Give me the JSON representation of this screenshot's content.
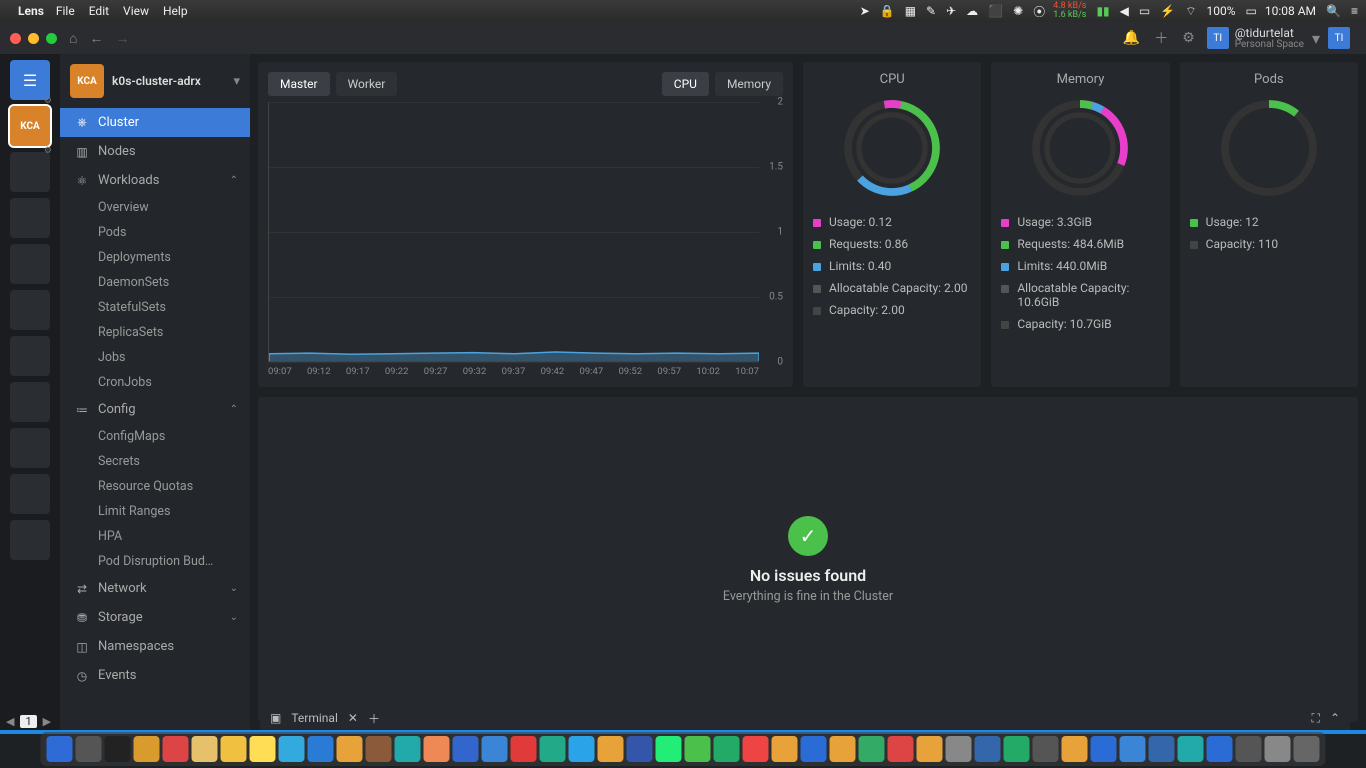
{
  "menubar": {
    "app": "Lens",
    "items": [
      "File",
      "Edit",
      "View",
      "Help"
    ],
    "net_up": "4.8 kB/s",
    "net_dn": "1.6 kB/s",
    "battery": "100%",
    "clock": "10:08 AM"
  },
  "user": {
    "initials": "TI",
    "handle": "@tidurtelat",
    "space": "Personal Space"
  },
  "rail": {
    "cluster_badge": "KCA"
  },
  "cluster": {
    "name": "k0s-cluster-adrx",
    "badge": "KCA"
  },
  "sidebar": {
    "cluster": "Cluster",
    "nodes": "Nodes",
    "workloads": "Workloads",
    "workloads_items": [
      "Overview",
      "Pods",
      "Deployments",
      "DaemonSets",
      "StatefulSets",
      "ReplicaSets",
      "Jobs",
      "CronJobs"
    ],
    "config": "Config",
    "config_items": [
      "ConfigMaps",
      "Secrets",
      "Resource Quotas",
      "Limit Ranges",
      "HPA",
      "Pod Disruption Bud…"
    ],
    "network": "Network",
    "storage": "Storage",
    "namespaces": "Namespaces",
    "events": "Events"
  },
  "chart_tabs": {
    "left": [
      "Master",
      "Worker"
    ],
    "right": [
      "CPU",
      "Memory"
    ]
  },
  "chart_data": {
    "type": "line",
    "ylim": [
      0,
      2
    ],
    "yticks": [
      0,
      0.5,
      1,
      1.5,
      2
    ],
    "x": [
      "09:07",
      "09:12",
      "09:17",
      "09:22",
      "09:27",
      "09:32",
      "09:37",
      "09:42",
      "09:47",
      "09:52",
      "09:57",
      "10:02",
      "10:07"
    ],
    "series": [
      {
        "name": "CPU usage",
        "color": "#4aa3e0",
        "values": [
          0.13,
          0.14,
          0.12,
          0.13,
          0.14,
          0.15,
          0.13,
          0.16,
          0.14,
          0.13,
          0.14,
          0.13,
          0.14
        ]
      }
    ],
    "ylabel": "",
    "xlabel": ""
  },
  "metrics": {
    "cpu": {
      "title": "CPU",
      "legend": [
        {
          "c": "sw-pink",
          "t": "Usage: 0.12"
        },
        {
          "c": "sw-green",
          "t": "Requests: 0.86"
        },
        {
          "c": "sw-blue",
          "t": "Limits: 0.40"
        },
        {
          "c": "sw-gray",
          "t": "Allocatable Capacity: 2.00"
        },
        {
          "c": "sw-dgray",
          "t": "Capacity: 2.00"
        }
      ]
    },
    "memory": {
      "title": "Memory",
      "legend": [
        {
          "c": "sw-pink",
          "t": "Usage: 3.3GiB"
        },
        {
          "c": "sw-green",
          "t": "Requests: 484.6MiB"
        },
        {
          "c": "sw-blue",
          "t": "Limits: 440.0MiB"
        },
        {
          "c": "sw-gray",
          "t": "Allocatable Capacity: 10.6GiB"
        },
        {
          "c": "sw-dgray",
          "t": "Capacity: 10.7GiB"
        }
      ]
    },
    "pods": {
      "title": "Pods",
      "legend": [
        {
          "c": "sw-green",
          "t": "Usage: 12"
        },
        {
          "c": "sw-dgray",
          "t": "Capacity: 110"
        }
      ]
    }
  },
  "issues": {
    "title": "No issues found",
    "sub": "Everything is fine in the Cluster"
  },
  "terminal": {
    "label": "Terminal"
  },
  "pager": {
    "page": "1"
  },
  "dock_colors": [
    "#2e6bd6",
    "#555",
    "#222",
    "#d99a2e",
    "#d44",
    "#e4c16a",
    "#f0c040",
    "#ffdd55",
    "#3ad",
    "#2a7bd6",
    "#e8a23a",
    "#8a5a3a",
    "#2aa",
    "#e85",
    "#36c",
    "#3a85d6",
    "#e03a3a",
    "#2a8",
    "#2aa3e8",
    "#e8a23a",
    "#35a",
    "#2e7",
    "#4bc04b",
    "#2a6",
    "#e44",
    "#e8a23a",
    "#2a6bd6",
    "#e8a23a",
    "#3a6",
    "#d44",
    "#e8a23a",
    "#888",
    "#36a",
    "#2a6",
    "#555",
    "#e8a23a",
    "#2a6bd6",
    "#3a85d6",
    "#36a",
    "#2aa",
    "#2a6bd6",
    "#555",
    "#888",
    "#666"
  ]
}
